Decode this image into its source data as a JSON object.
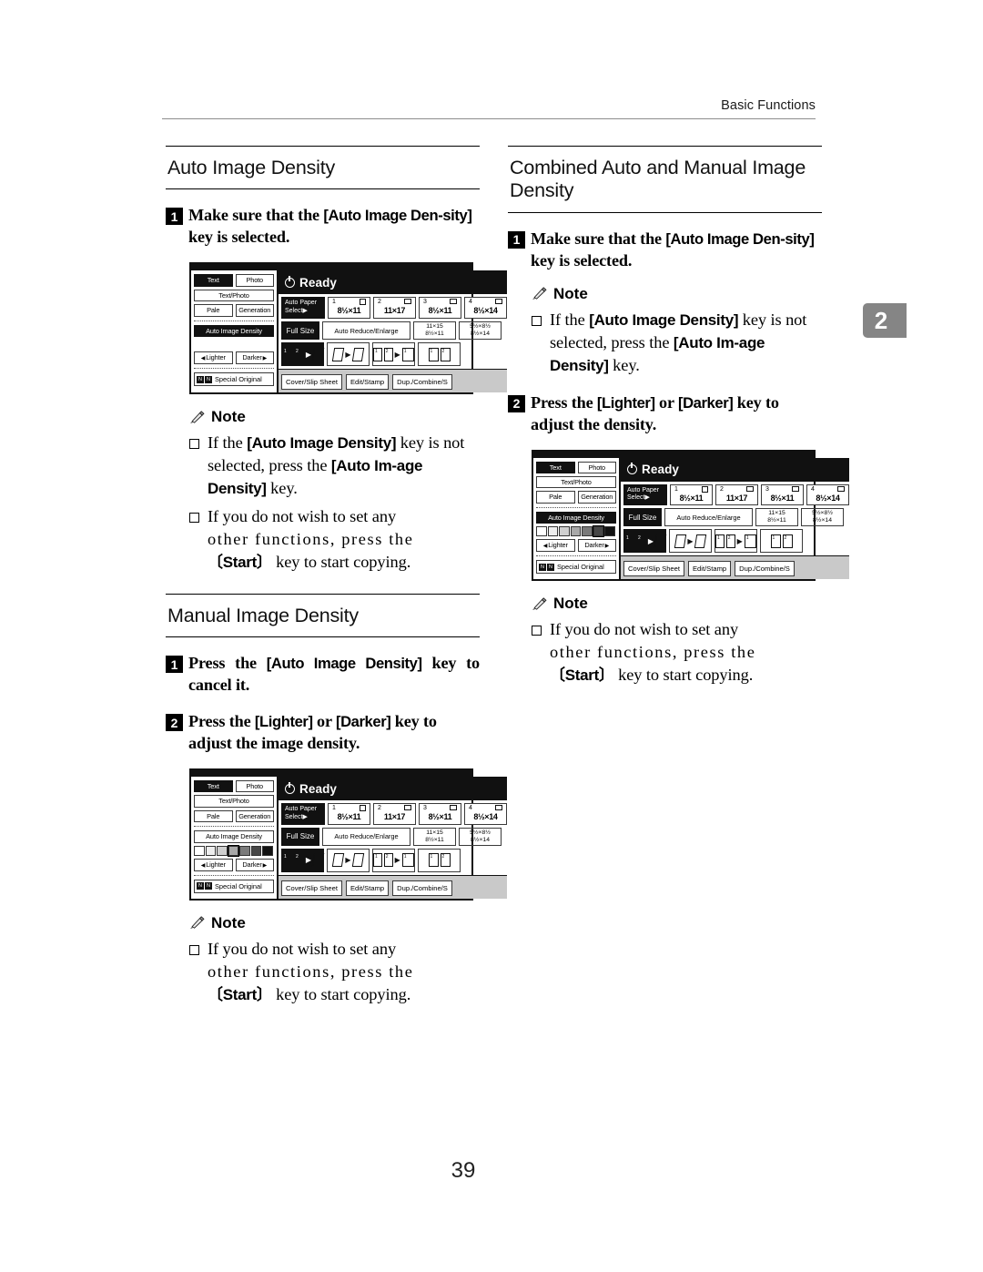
{
  "header": {
    "title": "Basic Functions"
  },
  "chapter_tab": {
    "number": "2"
  },
  "page_number": "39",
  "left_column": {
    "section1": {
      "title": "Auto Image Density",
      "steps": [
        {
          "num": "1",
          "text_pre": "Make sure that the ",
          "key": "[Auto Image Den-sity]",
          "text_post": " key is selected."
        }
      ],
      "note": {
        "label": "Note",
        "items": [
          {
            "l1_pre": "If the ",
            "l1_key": "[Auto Image Density]",
            "l1_post": " key is",
            "l2_pre": "not selected, press the ",
            "l2_key": "[Auto Im-",
            "l3_key": "age Density]",
            "l3_post": " key."
          },
          {
            "l1": "If you do not wish to set any",
            "l2": "other functions, press the",
            "l3_key": "〔Start〕",
            "l3_post": " key to start copying."
          }
        ]
      }
    },
    "section2": {
      "title": "Manual Image Density",
      "steps": [
        {
          "num": "1",
          "text_pre": "Press the ",
          "key": "[Auto Image Density]",
          "text_post": " key to cancel it."
        },
        {
          "num": "2",
          "text_pre": "Press the ",
          "key": "[Lighter]",
          "mid": " or ",
          "key2": "[Darker]",
          "text_post": " key to adjust the image density."
        }
      ],
      "note": {
        "label": "Note",
        "items": [
          {
            "l1": "If you do not wish to set any",
            "l2": "other functions, press the",
            "l3_key": "〔Start〕",
            "l3_post": " key to start copying."
          }
        ]
      }
    }
  },
  "right_column": {
    "section1": {
      "title": "Combined Auto and Manual Image Density",
      "steps": [
        {
          "num": "1",
          "text_pre": "Make sure that the ",
          "key": "[Auto Image Den-sity]",
          "text_post": " key is selected."
        },
        {
          "num": "2",
          "text_pre": "Press the ",
          "key": "[Lighter]",
          "mid": " or ",
          "key2": "[Darker]",
          "text_post": " key to adjust the density."
        }
      ],
      "note_top": {
        "label": "Note",
        "items": [
          {
            "l1_pre": "If the ",
            "l1_key": "[Auto Image Density]",
            "l1_post": " key is",
            "l2_pre": "not selected, press the ",
            "l2_key": "[Auto Im-",
            "l3_key": "age Density]",
            "l3_post": " key."
          }
        ]
      },
      "note_bottom": {
        "label": "Note",
        "items": [
          {
            "l1": "If you do not wish to set any",
            "l2": "other functions, press the",
            "l3_key": "〔Start〕",
            "l3_post": " key to start copying."
          }
        ]
      }
    }
  },
  "lcd": {
    "status": "Ready",
    "left_buttons": {
      "text": "Text",
      "photo": "Photo",
      "text_photo": "Text/Photo",
      "pale": "Pale",
      "generation": "Generation",
      "auto_image_density": "Auto Image Density",
      "lighter": "Lighter",
      "darker": "Darker",
      "special_original": "Special Original"
    },
    "paper_row": {
      "auto_paper_select_l1": "Auto Paper",
      "auto_paper_select_l2": "Select",
      "trays": [
        {
          "num": "1",
          "size": "8½×11"
        },
        {
          "num": "2",
          "size": "11×17"
        },
        {
          "num": "3",
          "size": "8½×11"
        },
        {
          "num": "4",
          "size": "8½×14"
        }
      ]
    },
    "zoom_row": {
      "full_size": "Full Size",
      "auto_reduce_enlarge": "Auto Reduce/Enlarge",
      "ratios": [
        {
          "top": "11×15",
          "bot": "8½×11"
        },
        {
          "top": "5½×8½",
          "bot": "8½×14"
        }
      ]
    },
    "tabs": [
      "Cover/Slip Sheet",
      "Edit/Stamp",
      "Dup./Combine/S"
    ],
    "density_scale": {
      "steps": 7,
      "selected_manual": 4,
      "selected_combined": 6
    }
  }
}
